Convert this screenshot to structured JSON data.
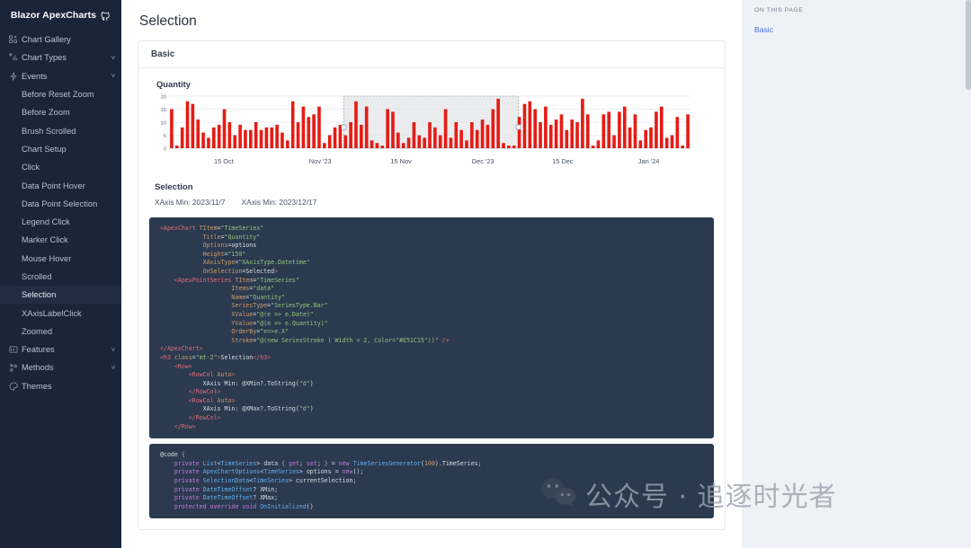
{
  "brand": {
    "title": "Blazor ApexCharts",
    "icon": "github-icon"
  },
  "sidebar": {
    "items": [
      {
        "label": "Chart Gallery",
        "icon": "gallery-icon",
        "expandable": false
      },
      {
        "label": "Chart Types",
        "icon": "bar-chart-icon",
        "expandable": true
      },
      {
        "label": "Events",
        "icon": "lightning-icon",
        "expandable": true
      }
    ],
    "events_children": [
      "Before Reset Zoom",
      "Before Zoom",
      "Brush Scrolled",
      "Chart Setup",
      "Click",
      "Data Point Hover",
      "Data Point Selection",
      "Legend Click",
      "Marker Click",
      "Mouse Hover",
      "Scrolled",
      "Selection",
      "XAxisLabelClick",
      "Zoomed"
    ],
    "active_child": "Selection",
    "bottom_items": [
      {
        "label": "Features",
        "icon": "features-icon",
        "expandable": true
      },
      {
        "label": "Methods",
        "icon": "methods-icon",
        "expandable": true
      },
      {
        "label": "Themes",
        "icon": "themes-icon",
        "expandable": false
      }
    ],
    "chevron": "˅"
  },
  "page": {
    "title": "Selection",
    "card_header": "Basic"
  },
  "selection": {
    "heading": "Selection",
    "xmin_label": "XAxis Min: 2023/11/7",
    "xmax_label": "XAxis Min: 2023/12/17"
  },
  "toc": {
    "heading": "ON THIS PAGE",
    "links": [
      "Basic"
    ]
  },
  "watermark": {
    "text": "公众号 · 追逐时光者",
    "icon": "wechat-icon"
  },
  "colors": {
    "bar": "#E51C15",
    "bar_fill": "#e0342c",
    "sidebar_bg": "#1b2539",
    "code_bg": "#2b3a4f",
    "toc_link": "#3d74d8",
    "page_bg": "#eef1f6"
  },
  "chart_data": {
    "type": "bar",
    "title": "Quantity",
    "xlabel": "",
    "ylabel": "",
    "ylim": [
      0,
      20
    ],
    "yticks": [
      0,
      5,
      10,
      15,
      20
    ],
    "grid": true,
    "legend": "none",
    "xtick_labels": [
      "15 Oct",
      "Nov '23",
      "15 Nov",
      "Dec '23",
      "15 Dec",
      "Jan '24"
    ],
    "xtick_positions_pct": [
      10.5,
      29.0,
      44.5,
      60.2,
      75.5,
      92.0
    ],
    "selection": {
      "x_start_pct": 33.5,
      "x_end_pct": 67.0,
      "label_min": "2023/11/7",
      "label_max": "2023/12/17"
    },
    "series": [
      {
        "name": "Quantity",
        "color": "#E51C15",
        "values": [
          15,
          1,
          8,
          18,
          17,
          11,
          6,
          4,
          8,
          9,
          15,
          10,
          5,
          9,
          7,
          7,
          10,
          7,
          8,
          8,
          9,
          6,
          3,
          18,
          10,
          16,
          12,
          13,
          16,
          2,
          5,
          8,
          9,
          5,
          10,
          18,
          9,
          16,
          3,
          2,
          1,
          15,
          14,
          6,
          2,
          4,
          10,
          5,
          4,
          10,
          8,
          5,
          15,
          4,
          10,
          7,
          3,
          10,
          7,
          11,
          9,
          15,
          19,
          2,
          1,
          1,
          12,
          17,
          18,
          15,
          10,
          16,
          9,
          11,
          13,
          7,
          11,
          10,
          19,
          13,
          1,
          3,
          13,
          14,
          5,
          14,
          16,
          8,
          13,
          3,
          7,
          8,
          14,
          16,
          4,
          5,
          12,
          1,
          13
        ]
      }
    ]
  },
  "code": {
    "block1": [
      [
        [
          "tag",
          "<ApexChart "
        ],
        [
          "attr",
          "TItem"
        ],
        [
          "plain",
          "="
        ],
        [
          "str",
          "\"TimeSeries\""
        ]
      ],
      [
        [
          "plain",
          "            "
        ],
        [
          "attr",
          "Title"
        ],
        [
          "plain",
          "="
        ],
        [
          "str",
          "\"Quantity\""
        ]
      ],
      [
        [
          "plain",
          "            "
        ],
        [
          "attr",
          "Options"
        ],
        [
          "plain",
          "=options"
        ]
      ],
      [
        [
          "plain",
          "            "
        ],
        [
          "attr",
          "Height"
        ],
        [
          "plain",
          "="
        ],
        [
          "str",
          "\"150\""
        ]
      ],
      [
        [
          "plain",
          "            "
        ],
        [
          "attr",
          "XAxisType"
        ],
        [
          "plain",
          "="
        ],
        [
          "str",
          "\"XAxisType.Datetime\""
        ]
      ],
      [
        [
          "plain",
          "            "
        ],
        [
          "attr",
          "OnSelection"
        ],
        [
          "plain",
          "=Selected"
        ],
        [
          "tag",
          ">"
        ]
      ],
      [
        [
          "plain",
          ""
        ]
      ],
      [
        [
          "plain",
          "    "
        ],
        [
          "tag",
          "<ApexPointSeries "
        ],
        [
          "attr",
          "TItem"
        ],
        [
          "plain",
          "="
        ],
        [
          "str",
          "\"TimeSeries\""
        ]
      ],
      [
        [
          "plain",
          "                    "
        ],
        [
          "attr",
          "Items"
        ],
        [
          "plain",
          "="
        ],
        [
          "str",
          "\"data\""
        ]
      ],
      [
        [
          "plain",
          "                    "
        ],
        [
          "attr",
          "Name"
        ],
        [
          "plain",
          "="
        ],
        [
          "str",
          "\"Quantity\""
        ]
      ],
      [
        [
          "plain",
          "                    "
        ],
        [
          "attr",
          "SeriesType"
        ],
        [
          "plain",
          "="
        ],
        [
          "str",
          "\"SeriesType.Bar\""
        ]
      ],
      [
        [
          "plain",
          "                    "
        ],
        [
          "attr",
          "XValue"
        ],
        [
          "plain",
          "="
        ],
        [
          "str",
          "\"@(e => e.Date)\""
        ]
      ],
      [
        [
          "plain",
          "                    "
        ],
        [
          "attr",
          "YValue"
        ],
        [
          "plain",
          "="
        ],
        [
          "str",
          "\"@(e => e.Quantity)\""
        ]
      ],
      [
        [
          "plain",
          "                    "
        ],
        [
          "attr",
          "OrderBy"
        ],
        [
          "plain",
          "="
        ],
        [
          "str",
          "\"e=>e.X\""
        ]
      ],
      [
        [
          "plain",
          "                    "
        ],
        [
          "attr",
          "Stroke"
        ],
        [
          "plain",
          "="
        ],
        [
          "str",
          "\"@(new SeriesStroke ( Width = 2, Color=\"#E51C15\"))\""
        ],
        [
          "plain",
          " "
        ],
        [
          "tag",
          "/>"
        ]
      ],
      [
        [
          "tag",
          "</ApexChart>"
        ]
      ],
      [
        [
          "plain",
          ""
        ]
      ],
      [
        [
          "tag",
          "<h3 "
        ],
        [
          "attr",
          "class"
        ],
        [
          "plain",
          "="
        ],
        [
          "str",
          "\"mt-2\""
        ],
        [
          "tag",
          ">"
        ],
        [
          "plain",
          "Selection"
        ],
        [
          "tag",
          "</h3>"
        ]
      ],
      [
        [
          "plain",
          "    "
        ],
        [
          "tag",
          "<Row>"
        ]
      ],
      [
        [
          "plain",
          "        "
        ],
        [
          "tag",
          "<RowCol "
        ],
        [
          "attr",
          "Auto"
        ],
        [
          "tag",
          ">"
        ]
      ],
      [
        [
          "plain",
          "            XAxis Min: @XMin?.ToString("
        ],
        [
          "str",
          "\"d\""
        ],
        [
          "plain",
          ")"
        ]
      ],
      [
        [
          "plain",
          "        "
        ],
        [
          "tag",
          "</RowCol>"
        ]
      ],
      [
        [
          "plain",
          "        "
        ],
        [
          "tag",
          "<RowCol "
        ],
        [
          "attr",
          "Auto"
        ],
        [
          "tag",
          ">"
        ]
      ],
      [
        [
          "plain",
          "            XAxis Min: @XMax?.ToString("
        ],
        [
          "str",
          "\"d\""
        ],
        [
          "plain",
          ")"
        ]
      ],
      [
        [
          "plain",
          "        "
        ],
        [
          "tag",
          "</RowCol>"
        ]
      ],
      [
        [
          "plain",
          "    "
        ],
        [
          "tag",
          "</Row>"
        ]
      ]
    ],
    "block2": [
      [
        [
          "plain",
          "@code "
        ],
        [
          "cbrace",
          "{"
        ]
      ],
      [
        [
          "plain",
          "    "
        ],
        [
          "kw",
          "private"
        ],
        [
          "plain",
          " "
        ],
        [
          "typ",
          "List"
        ],
        [
          "plain",
          "<"
        ],
        [
          "typ",
          "TimeSeries"
        ],
        [
          "plain",
          "> data "
        ],
        [
          "cbrace",
          "{"
        ],
        [
          "plain",
          " "
        ],
        [
          "kw",
          "get"
        ],
        [
          "plain",
          "; "
        ],
        [
          "kw",
          "set"
        ],
        [
          "plain",
          "; "
        ],
        [
          "cbrace",
          "}"
        ],
        [
          "plain",
          " = "
        ],
        [
          "kw",
          "new"
        ],
        [
          "plain",
          " "
        ],
        [
          "typ",
          "TimeSeriesGenerator"
        ],
        [
          "plain",
          "("
        ],
        [
          "num",
          "100"
        ],
        [
          "plain",
          ").TimeSeries;"
        ]
      ],
      [
        [
          "plain",
          "    "
        ],
        [
          "kw",
          "private"
        ],
        [
          "plain",
          " "
        ],
        [
          "typ",
          "ApexChartOptions"
        ],
        [
          "plain",
          "<"
        ],
        [
          "typ",
          "TimeSeries"
        ],
        [
          "plain",
          "> options = "
        ],
        [
          "kw",
          "new"
        ],
        [
          "plain",
          "();"
        ]
      ],
      [
        [
          "plain",
          "    "
        ],
        [
          "kw",
          "private"
        ],
        [
          "plain",
          " "
        ],
        [
          "typ",
          "SelectionData"
        ],
        [
          "plain",
          "<"
        ],
        [
          "typ",
          "TimeSeries"
        ],
        [
          "plain",
          "> currentSelection;"
        ]
      ],
      [
        [
          "plain",
          ""
        ]
      ],
      [
        [
          "plain",
          "    "
        ],
        [
          "kw",
          "private"
        ],
        [
          "plain",
          " "
        ],
        [
          "typ",
          "DateTimeOffset"
        ],
        [
          "plain",
          "? XMin;"
        ]
      ],
      [
        [
          "plain",
          "    "
        ],
        [
          "kw",
          "private"
        ],
        [
          "plain",
          " "
        ],
        [
          "typ",
          "DateTimeOffset"
        ],
        [
          "plain",
          "? XMax;"
        ]
      ],
      [
        [
          "plain",
          ""
        ]
      ],
      [
        [
          "plain",
          "    "
        ],
        [
          "kw",
          "protected override void"
        ],
        [
          "plain",
          " "
        ],
        [
          "fn",
          "OnInitialized"
        ],
        [
          "plain",
          "()"
        ]
      ]
    ]
  }
}
